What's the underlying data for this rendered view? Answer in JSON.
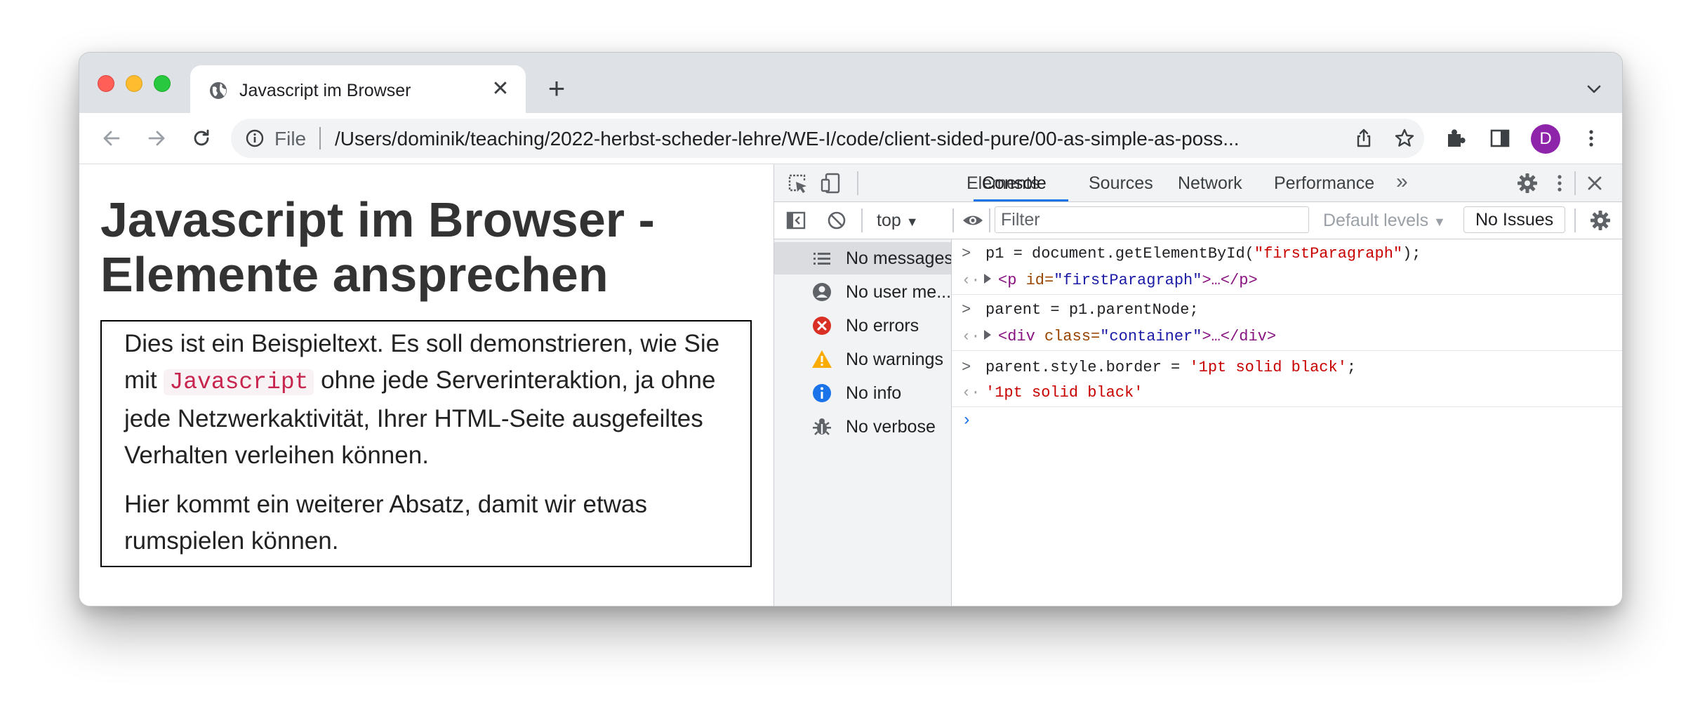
{
  "browser": {
    "tab": {
      "title": "Javascript im Browser",
      "close_glyph": "✕"
    },
    "new_tab_glyph": "+",
    "address": {
      "scheme_label": "File",
      "url": "/Users/dominik/teaching/2022-herbst-scheder-lehre/WE-I/code/client-sided-pure/00-as-simple-as-poss..."
    },
    "profile_initial": "D"
  },
  "page": {
    "heading": "Javascript im Browser - Elemente ansprechen",
    "paragraph1": {
      "before": "Dies ist ein Beispieltext. Es soll demonstrieren, wie Sie mit ",
      "code": "Javascript",
      "after": " ohne jede Serverinteraktion, ja ohne jede Netzwerkaktivität, Ihrer HTML-Seite ausgefeiltes Verhalten verleihen können."
    },
    "paragraph2": "Hier kommt ein weiterer Absatz, damit wir etwas rumspielen können."
  },
  "devtools": {
    "tabs": [
      "Elements",
      "Console",
      "Sources",
      "Network",
      "Performance"
    ],
    "active_tab": "Console",
    "more_tabs_glyph": "»",
    "toolbar": {
      "context": "top",
      "filter_placeholder": "Filter",
      "levels": "Default levels",
      "issues": "No Issues"
    },
    "sidebar": [
      {
        "label": "No messages",
        "icon": "list-icon",
        "selected": true
      },
      {
        "label": "No user me...",
        "icon": "user-icon"
      },
      {
        "label": "No errors",
        "icon": "error-icon"
      },
      {
        "label": "No warnings",
        "icon": "warning-icon"
      },
      {
        "label": "No info",
        "icon": "info-icon"
      },
      {
        "label": "No verbose",
        "icon": "bug-icon"
      }
    ],
    "console": {
      "in1": {
        "pre": "p1 = document.getElementById(",
        "str": "\"firstParagraph\"",
        "post": ");"
      },
      "out1": {
        "open": "<p",
        "attr": " id=",
        "value": "\"firstParagraph\"",
        "close": ">…</p>"
      },
      "in2": "parent = p1.parentNode;",
      "out2": {
        "open": "<div",
        "attr": " class=",
        "value": "\"container\"",
        "close": ">…</div>"
      },
      "in3": {
        "pre": "parent.style.border = ",
        "str": "'1pt solid black'",
        "post": ";"
      },
      "out3": "'1pt solid black'",
      "input_prompt": "›",
      "echo_prompt": "‹·",
      "return_prompt": ">"
    }
  },
  "colors": {
    "accent": "#1a73e8",
    "avatar": "#8e24aa",
    "error": "#d93025",
    "warning": "#f9ab00",
    "info": "#1a73e8",
    "code_text": "#c7254e"
  }
}
